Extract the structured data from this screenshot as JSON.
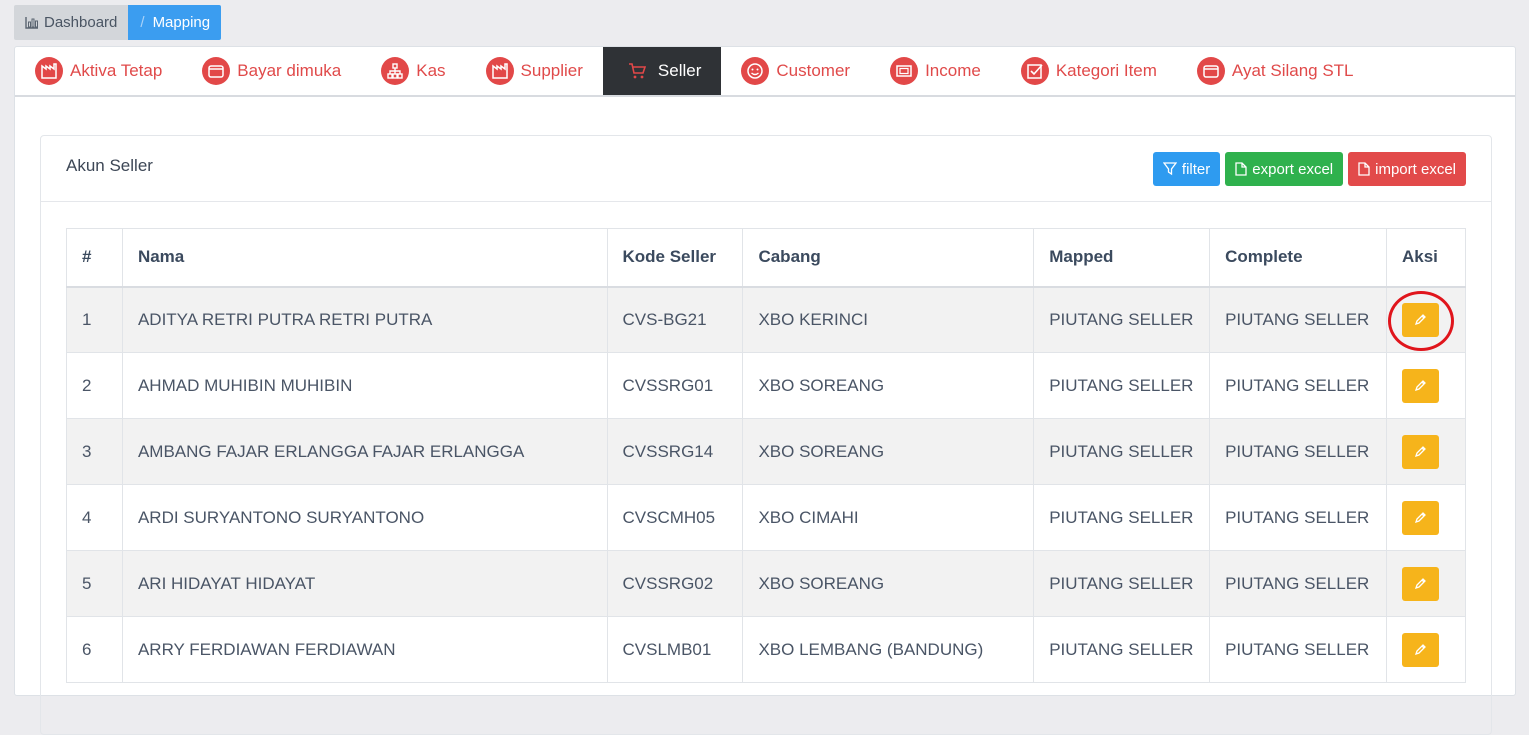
{
  "breadcrumb": {
    "home_label": "Dashboard",
    "separator": "/",
    "current_label": "Mapping"
  },
  "tabs": [
    {
      "label": "Aktiva Tetap",
      "icon": "factory-icon",
      "active": false
    },
    {
      "label": "Bayar dimuka",
      "icon": "wallet-icon",
      "active": false
    },
    {
      "label": "Kas",
      "icon": "sitemap-icon",
      "active": false
    },
    {
      "label": "Supplier",
      "icon": "factory-icon",
      "active": false
    },
    {
      "label": "Seller",
      "icon": "cart-icon",
      "active": true
    },
    {
      "label": "Customer",
      "icon": "smile-icon",
      "active": false
    },
    {
      "label": "Income",
      "icon": "money-icon",
      "active": false
    },
    {
      "label": "Kategori Item",
      "icon": "checkbox-icon",
      "active": false
    },
    {
      "label": "Ayat Silang STL",
      "icon": "wallet-icon",
      "active": false
    }
  ],
  "card": {
    "title": "Akun Seller",
    "filter_label": "filter",
    "export_label": "export excel",
    "import_label": "import excel"
  },
  "table": {
    "headers": [
      "#",
      "Nama",
      "Kode Seller",
      "Cabang",
      "Mapped",
      "Complete",
      "Aksi"
    ],
    "rows": [
      [
        "1",
        "ADITYA RETRI PUTRA RETRI PUTRA",
        "CVS-BG21",
        "XBO KERINCI",
        "PIUTANG SELLER",
        "PIUTANG SELLER"
      ],
      [
        "2",
        "AHMAD MUHIBIN MUHIBIN",
        "CVSSRG01",
        "XBO SOREANG",
        "PIUTANG SELLER",
        "PIUTANG SELLER"
      ],
      [
        "3",
        "AMBANG FAJAR ERLANGGA FAJAR ERLANGGA",
        "CVSSRG14",
        "XBO SOREANG",
        "PIUTANG SELLER",
        "PIUTANG SELLER"
      ],
      [
        "4",
        "ARDI SURYANTONO SURYANTONO",
        "CVSCMH05",
        "XBO CIMAHI",
        "PIUTANG SELLER",
        "PIUTANG SELLER"
      ],
      [
        "5",
        "ARI HIDAYAT HIDAYAT",
        "CVSSRG02",
        "XBO SOREANG",
        "PIUTANG SELLER",
        "PIUTANG SELLER"
      ],
      [
        "6",
        "ARRY FERDIAWAN FERDIAWAN",
        "CVSLMB01",
        "XBO LEMBANG (BANDUNG)",
        "PIUTANG SELLER",
        "PIUTANG SELLER"
      ]
    ]
  },
  "colors": {
    "tab_red": "#e24848",
    "tab_active_bg": "#2f3236",
    "edit_yellow": "#f6b41b",
    "highlight_ring": "#e0151c"
  }
}
